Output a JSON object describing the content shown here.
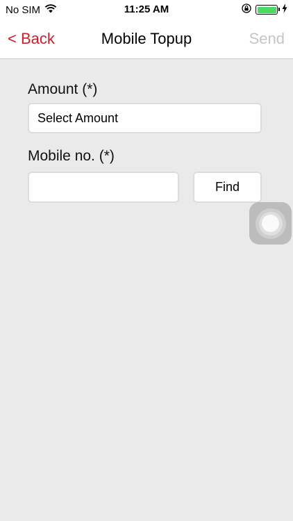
{
  "status_bar": {
    "carrier": "No SIM",
    "time": "11:25 AM",
    "battery_color": "#4cd964"
  },
  "nav": {
    "back_label": "< Back",
    "title": "Mobile Topup",
    "send_label": "Send",
    "accent_color": "#c61f2e"
  },
  "form": {
    "amount_label": "Amount (*)",
    "amount_value": "Select Amount",
    "mobile_label": "Mobile no. (*)",
    "mobile_value": "",
    "find_label": "Find"
  },
  "icons": {
    "wifi": "wifi-icon",
    "orientation_lock": "orientation-lock-icon",
    "battery": "battery-icon",
    "charging": "charging-bolt-icon",
    "assistive_touch": "assistive-touch-icon"
  }
}
